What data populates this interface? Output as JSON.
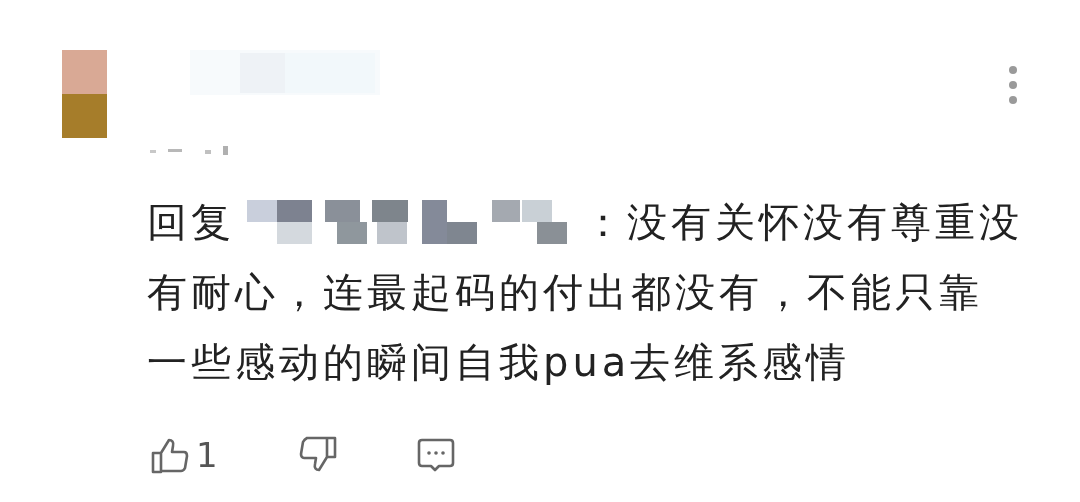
{
  "comment": {
    "reply_prefix": "回复",
    "text_lines": [
      "：没有关怀没有尊重没",
      "有耐心，连最起码的付出都没有，不能只靠",
      "一些感动的瞬间自我pua去维系感情"
    ],
    "like_count": "1"
  }
}
